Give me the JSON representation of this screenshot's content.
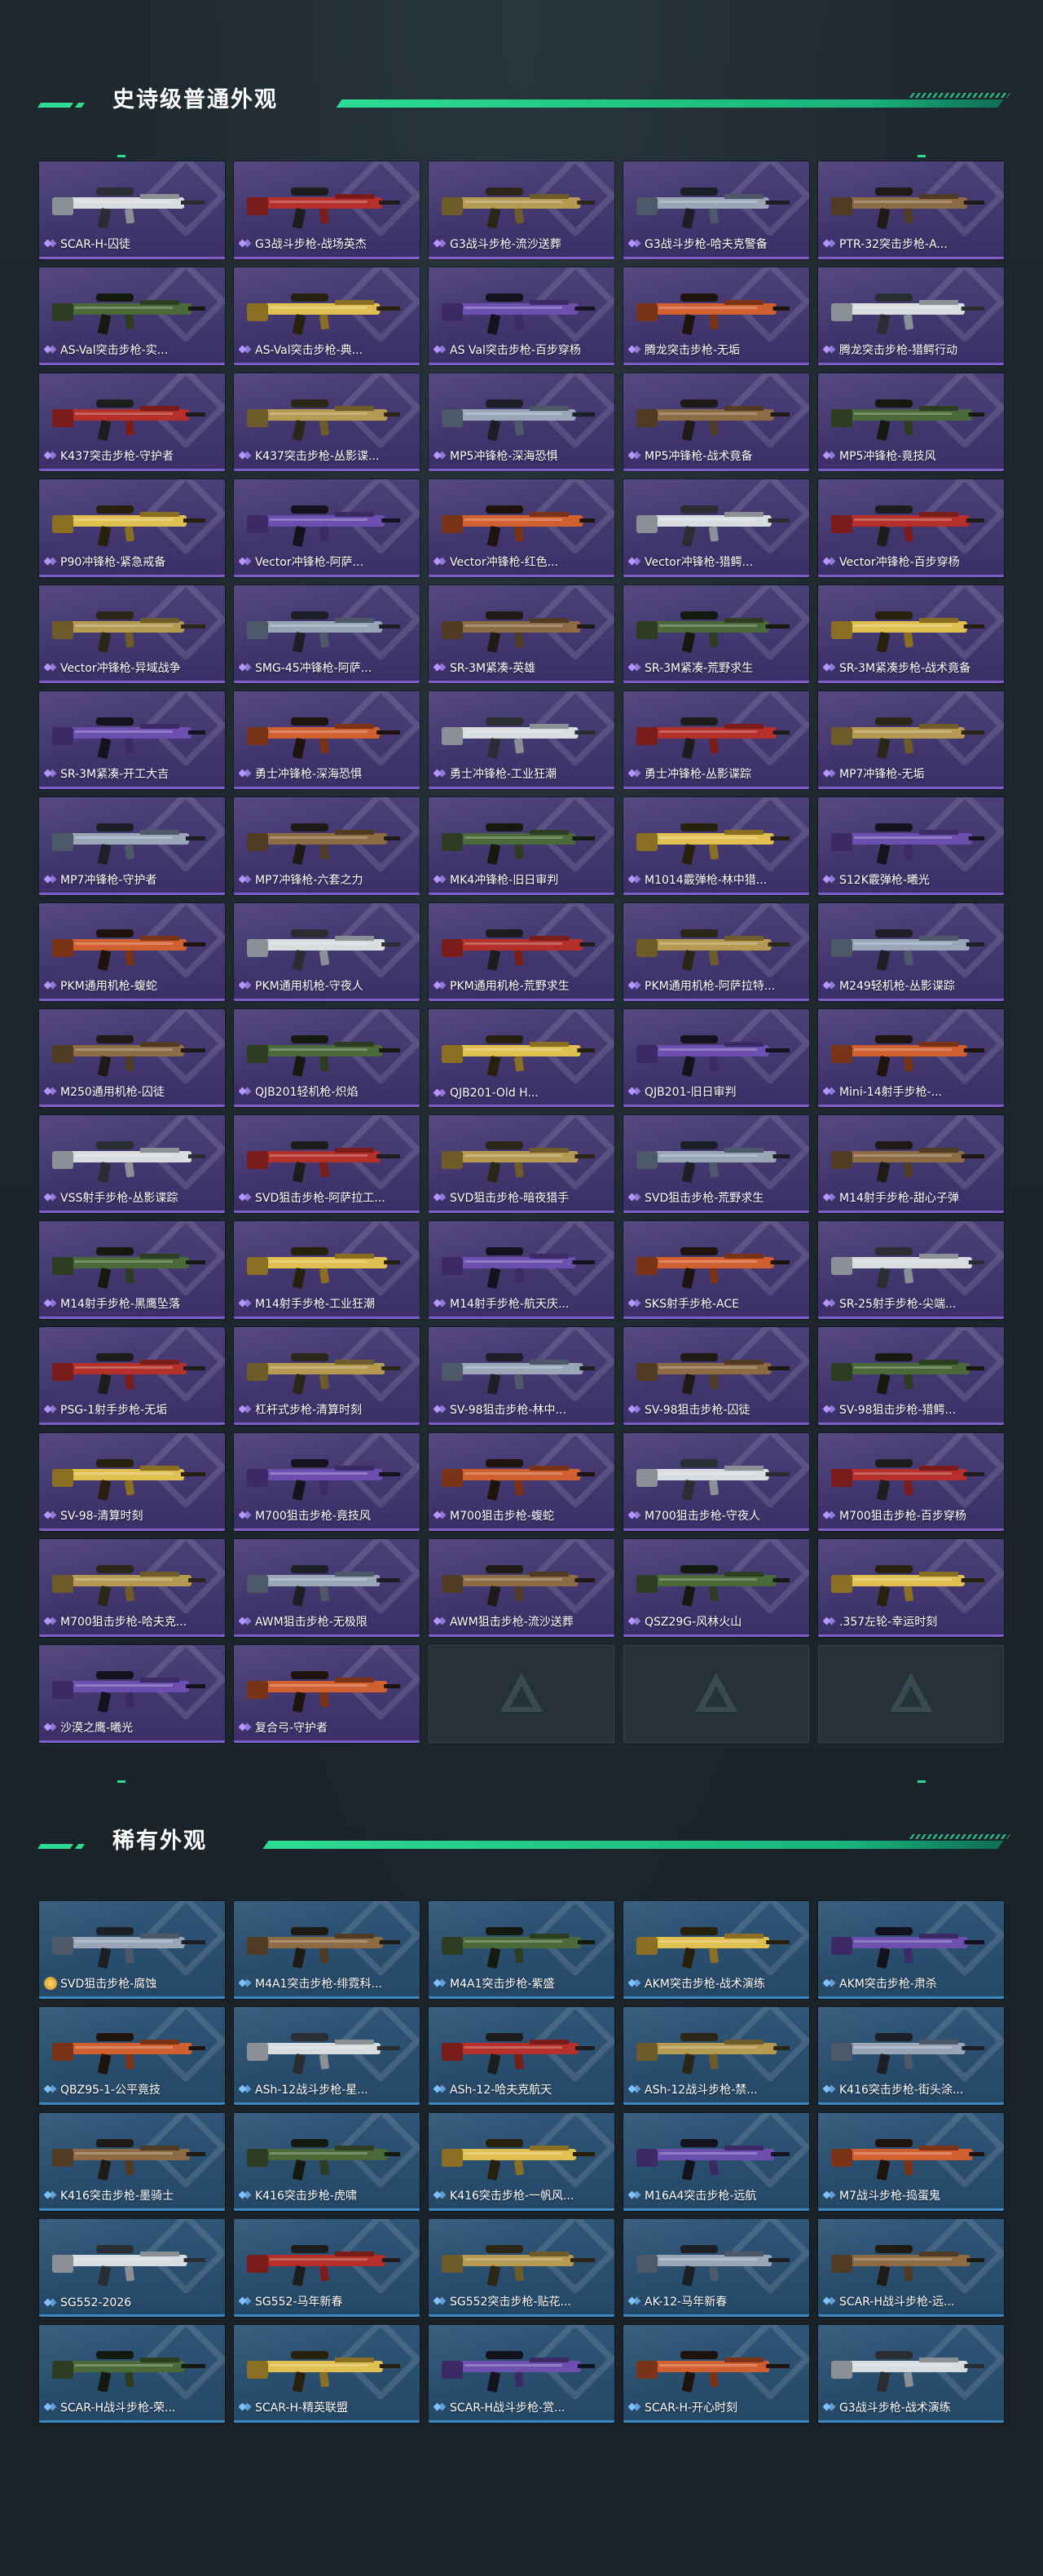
{
  "sections": {
    "epic": {
      "title": "史诗级普通外观",
      "rarity": "epic",
      "items": [
        "SCAR-H-囚徒",
        "G3战斗步枪-战场英杰",
        "G3战斗步枪-流沙送葬",
        "G3战斗步枪-哈夫克警备",
        "PTR-32突击步枪-A...",
        "AS-Val突击步枪-实...",
        "AS-Val突击步枪-典...",
        "AS Val突击步枪-百步穿杨",
        "腾龙突击步枪-无垢",
        "腾龙突击步枪-猎鳄行动",
        "K437突击步枪-守护者",
        "K437突击步枪-丛影谍...",
        "MP5冲锋枪-深海恐惧",
        "MP5冲锋枪-战术竟备",
        "MP5冲锋枪-竟技风",
        "P90冲锋枪-紧急戒备",
        "Vector冲锋枪-阿萨...",
        "Vector冲锋枪-红色...",
        "Vector冲锋枪-猎鳄...",
        "Vector冲锋枪-百步穿杨",
        "Vector冲锋枪-异域战争",
        "SMG-45冲锋枪-阿萨...",
        "SR-3M紧凑-英雄",
        "SR-3M紧凑-荒野求生",
        "SR-3M紧凑步枪-战术竟备",
        "SR-3M紧凑-开工大吉",
        "勇士冲锋枪-深海恐惧",
        "勇士冲锋枪-工业狂潮",
        "勇士冲锋枪-丛影谍踪",
        "MP7冲锋枪-无垢",
        "MP7冲锋枪-守护者",
        "MP7冲锋枪-六套之力",
        "MK4冲锋枪-旧日审判",
        "M1014霰弹枪-林中猎...",
        "S12K霰弹枪-曦光",
        "PKM通用机枪-蝮蛇",
        "PKM通用机枪-守夜人",
        "PKM通用机枪-荒野求生",
        "PKM通用机枪-阿萨拉特...",
        "M249轻机枪-丛影谍踪",
        "M250通用机枪-囚徒",
        "QJB201轻机枪-炽焰",
        "QJB201-Old H...",
        "QJB201-旧日审判",
        "Mini-14射手步枪-...",
        "VSS射手步枪-丛影谍踪",
        "SVD狙击步枪-阿萨拉工...",
        "SVD狙击步枪-暗夜猎手",
        "SVD狙击步枪-荒野求生",
        "M14射手步枪-甜心子弹",
        "M14射手步枪-黑鹰坠落",
        "M14射手步枪-工业狂潮",
        "M14射手步枪-航天庆...",
        "SKS射手步枪-ACE",
        "SR-25射手步枪-尖端...",
        "PSG-1射手步枪-无垢",
        "杠杆式步枪-清算时刻",
        "SV-98狙击步枪-林中...",
        "SV-98狙击步枪-囚徒",
        "SV-98狙击步枪-猎鳄...",
        "SV-98-清算时刻",
        "M700狙击步枪-竟技风",
        "M700狙击步枪-蝮蛇",
        "M700狙击步枪-守夜人",
        "M700狙击步枪-百步穿杨",
        "M700狙击步枪-哈夫克...",
        "AWM狙击步枪-无极限",
        "AWM狙击步枪-流沙送葬",
        "QSZ29G-风林火山",
        ".357左轮-幸运时刻",
        "沙漠之鹰-曦光",
        "复合弓-守护者"
      ],
      "empty_slots": 3
    },
    "rare": {
      "title": "稀有外观",
      "rarity": "rare",
      "items": [
        "SVD狙击步枪-腐蚀",
        "M4A1突击步枪-绯霓科...",
        "M4A1突击步枪-紫盛",
        "AKM突击步枪-战术演练",
        "AKM突击步枪-肃杀",
        "QBZ95-1-公平竟技",
        "ASh-12战斗步枪-星...",
        "ASh-12-哈夫克航天",
        "ASh-12战斗步枪-禁...",
        "K416突击步枪-街头涂...",
        "K416突击步枪-墨骑士",
        "K416突击步枪-虎啸",
        "K416突击步枪-一帆风...",
        "M16A4突击步枪-远航",
        "M7战斗步枪-捣蛋鬼",
        "SG552-2026",
        "SG552-马年新春",
        "SG552突击步枪-贴花...",
        "AK-12-马年新春",
        "SCAR-H战斗步枪-远...",
        "SCAR-H战斗步枪-荣...",
        "SCAR-H-精英联盟",
        "SCAR-H战斗步枪-赏...",
        "SCAR-H-开心时刻",
        "G3战斗步枪-战术演练"
      ]
    }
  },
  "colors": {
    "accent": "#2ddc92",
    "epic_card": "#3f3470",
    "rare_card": "#2a4f70",
    "background": "#1c252c"
  }
}
